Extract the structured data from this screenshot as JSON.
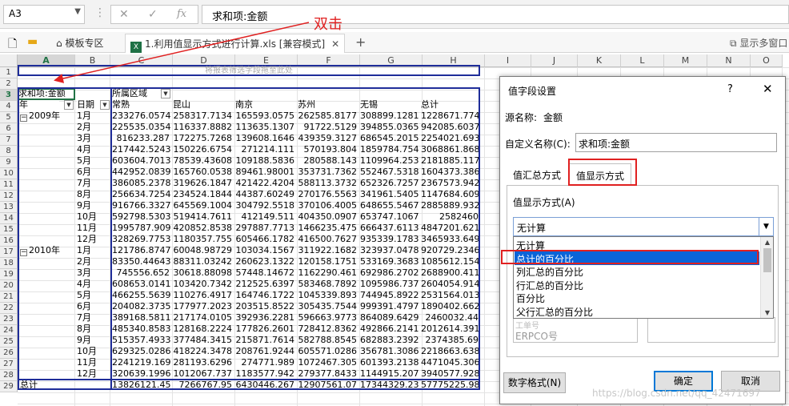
{
  "formula_bar": {
    "name_box": "A3",
    "cancel": "✕",
    "confirm": "✓",
    "fx": "fx",
    "content": "求和项:金额"
  },
  "annotation": {
    "label": "双击"
  },
  "tabs": {
    "items": [
      {
        "label": "模板专区"
      },
      {
        "label": "1.利用值显示方式进行计算.xls  [兼容模式]",
        "badge": "X"
      }
    ],
    "add": "+",
    "multiwindow": "显示多窗口"
  },
  "grid": {
    "columns": [
      "A",
      "B",
      "C",
      "D",
      "E",
      "F",
      "G",
      "H",
      "I",
      "J",
      "K",
      "L",
      "M",
      "N",
      "O"
    ],
    "selected_column": "A",
    "selected_row": "3",
    "rows": [
      "1",
      "2",
      "3",
      "4",
      "5",
      "6",
      "7",
      "8",
      "9",
      "10",
      "11",
      "12",
      "13",
      "14",
      "15",
      "16",
      "17",
      "18",
      "19",
      "20",
      "21",
      "22",
      "23",
      "24",
      "25",
      "26",
      "27",
      "28",
      "29"
    ],
    "filter_drop_hint": "将报表筛选字段拖至此处",
    "pivot": {
      "value_field": "求和项:金额",
      "col_field": "所属区域",
      "row_field_year": "年",
      "row_field_date": "日期",
      "col_headers": [
        "常熟",
        "昆山",
        "南京",
        "苏州",
        "无锡",
        "总计"
      ],
      "years": [
        "2009年",
        "2010年"
      ],
      "months": [
        "1月",
        "2月",
        "3月",
        "4月",
        "5月",
        "6月",
        "7月",
        "8月",
        "9月",
        "10月",
        "11月",
        "12月"
      ],
      "rows_2009": [
        [
          "233276.0574",
          "258317.7134",
          "165593.0575",
          "262585.8177",
          "308899.1281",
          "1228671.774"
        ],
        [
          "225535.0354",
          "116337.8882",
          "113635.1307",
          "91722.5129",
          "394855.0365",
          "942085.6037"
        ],
        [
          "816233.287",
          "172275.7268",
          "139608.1646",
          "439359.3127",
          "686545.2015",
          "2254021.693"
        ],
        [
          "217442.5243",
          "150226.6754",
          "271214.111",
          "570193.804",
          "1859784.754",
          "3068861.868"
        ],
        [
          "603604.7013",
          "78539.43608",
          "109188.5836",
          "280588.143",
          "1109964.253",
          "2181885.117"
        ],
        [
          "442952.0839",
          "165760.0538",
          "89461.98001",
          "353731.7362",
          "552467.5318",
          "1604373.386"
        ],
        [
          "386085.2378",
          "319626.1847",
          "421422.4204",
          "588113.3732",
          "652326.7257",
          "2367573.942"
        ],
        [
          "256634.7254",
          "234524.1844",
          "44387.60249",
          "270176.5563",
          "341961.5405",
          "1147684.609"
        ],
        [
          "916766.3327",
          "645569.1004",
          "304792.5518",
          "370106.4005",
          "648655.5467",
          "2885889.932"
        ],
        [
          "592798.5303",
          "519414.7611",
          "412149.511",
          "404350.0907",
          "653747.1067",
          "2582460"
        ],
        [
          "1995787.909",
          "420852.8538",
          "297887.7713",
          "1466235.475",
          "666437.6113",
          "4847201.621"
        ],
        [
          "328269.7753",
          "1180357.755",
          "605466.1782",
          "416500.7627",
          "935339.1783",
          "3465933.649"
        ]
      ],
      "rows_2010": [
        [
          "121786.8747",
          "60048.98729",
          "103034.1567",
          "311922.1682",
          "323937.0478",
          "920729.2346"
        ],
        [
          "83350.44643",
          "88311.03242",
          "260623.1322",
          "120158.1751",
          "533169.3683",
          "1085612.154"
        ],
        [
          "745556.652",
          "30618.88098",
          "57448.14672",
          "1162290.461",
          "692986.2702",
          "2688900.411"
        ],
        [
          "608653.0141",
          "103420.7342",
          "212525.6397",
          "583468.7892",
          "1095986.737",
          "2604054.914"
        ],
        [
          "466255.5639",
          "110276.4917",
          "164746.1722",
          "1045339.893",
          "744945.8922",
          "2531564.013"
        ],
        [
          "204082.3735",
          "177977.2023",
          "203515.8522",
          "305435.7544",
          "999391.4797",
          "1890402.662"
        ],
        [
          "389168.5811",
          "217174.0105",
          "392936.2281",
          "596663.9773",
          "864089.6429",
          "2460032.44"
        ],
        [
          "485340.8583",
          "128168.2224",
          "177826.2601",
          "728412.8362",
          "492866.2141",
          "2012614.391"
        ],
        [
          "515357.4933",
          "377484.3415",
          "215871.7614",
          "582788.8545",
          "682883.2392",
          "2374385.69"
        ],
        [
          "629325.0286",
          "418224.3478",
          "208761.9244",
          "605571.0286",
          "356781.3086",
          "2218663.638"
        ],
        [
          "2241219.169",
          "281193.6296",
          "274771.989",
          "1072467.305",
          "601393.2138",
          "4471045.306"
        ],
        [
          "320639.1996",
          "1012067.737",
          "1183577.942",
          "279377.8433",
          "1144915.207",
          "3940577.928"
        ]
      ],
      "total_label": "总计",
      "total_row": [
        "13826121.45",
        "7266767.95",
        "6430446.267",
        "12907561.07",
        "17344329.23",
        "57775225.98"
      ]
    }
  },
  "dialog": {
    "title": "值字段设置",
    "help": "?",
    "close": "✕",
    "source_label": "源名称:",
    "source_value": "金额",
    "custom_name_label": "自定义名称(C):",
    "custom_name_value": "求和项:金额",
    "tab_summary": "值汇总方式",
    "tab_show": "值显示方式",
    "show_as_label": "值显示方式(A)",
    "combo_value": "无计算",
    "options": [
      "无计算",
      "总计的百分比",
      "列汇总的百分比",
      "行汇总的百分比",
      "百分比",
      "父行汇总的百分比"
    ],
    "selected_option_index": 1,
    "base_fields": [
      "工单号",
      "ERPCO号"
    ],
    "number_format_button": "数字格式(N)",
    "ok_button": "确定",
    "cancel_button": "取消"
  },
  "watermark": "https://blog.csdn.net/qq_42471697",
  "colors": {
    "pivot_border": "#1f2d99",
    "annotation": "#e02020",
    "selection": "#0a64d8",
    "excel_green": "#217346"
  }
}
